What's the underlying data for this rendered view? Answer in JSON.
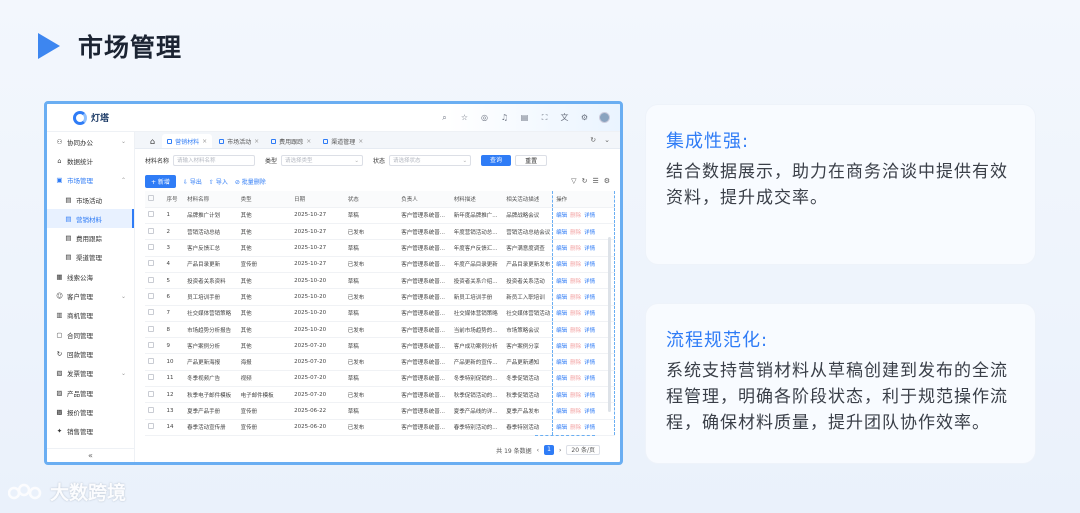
{
  "slide": {
    "title": "市场管理"
  },
  "app": {
    "logo": "灯塔",
    "sidebar": {
      "items": [
        {
          "label": "协同办公",
          "icon": "network-icon",
          "chevron": "⌄"
        },
        {
          "label": "数据统计",
          "icon": "home-icon"
        },
        {
          "label": "市场管理",
          "icon": "folder-icon",
          "chevron": "⌃",
          "open": true
        },
        {
          "label": "市场活动",
          "icon": "doc-icon",
          "sub": true
        },
        {
          "label": "营销材料",
          "icon": "doc-icon",
          "sub": true,
          "active": true
        },
        {
          "label": "费用跟踪",
          "icon": "doc-icon",
          "sub": true
        },
        {
          "label": "渠道管理",
          "icon": "doc-icon",
          "sub": true
        },
        {
          "label": "线索公海",
          "icon": "grid-icon"
        },
        {
          "label": "客户管理",
          "icon": "user-icon",
          "chevron": "⌄"
        },
        {
          "label": "商机管理",
          "icon": "chart-icon"
        },
        {
          "label": "合同管理",
          "icon": "file-icon"
        },
        {
          "label": "回款管理",
          "icon": "refresh-icon"
        },
        {
          "label": "发票管理",
          "icon": "invoice-icon",
          "chevron": "⌄"
        },
        {
          "label": "产品管理",
          "icon": "box-icon"
        },
        {
          "label": "报价管理",
          "icon": "price-icon"
        },
        {
          "label": "销售管理",
          "icon": "sales-icon"
        }
      ],
      "collapse": "«"
    },
    "tabs": [
      {
        "label": "营销材料",
        "active": true
      },
      {
        "label": "市场活动"
      },
      {
        "label": "费用跟踪"
      },
      {
        "label": "渠道管理"
      }
    ],
    "filter": {
      "name_label": "材料名称",
      "name_placeholder": "请输入材料名称",
      "type_label": "类型",
      "type_placeholder": "请选择类型",
      "status_label": "状态",
      "status_placeholder": "请选择状态",
      "search": "查询",
      "reset": "重置"
    },
    "toolbar": {
      "add": "+ 新增",
      "export": "导出",
      "import": "导入",
      "batch_delete": "批量删除"
    },
    "table": {
      "headers": [
        "序号",
        "材料名称",
        "类型",
        "日期",
        "状态",
        "负责人",
        "材料描述",
        "相关活动描述",
        "操作"
      ],
      "actions": {
        "edit": "编辑",
        "delete": "删除",
        "view": "详情"
      },
      "rows": [
        [
          "1",
          "品牌推广计划",
          "其他",
          "2025-10-27",
          "草稿",
          "客户管理系统普...",
          "新年度品牌推广...",
          "品牌战略会议"
        ],
        [
          "2",
          "营销活动总结",
          "其他",
          "2025-10-27",
          "已发布",
          "客户管理系统普...",
          "年度营销活动总...",
          "营销活动总结会议"
        ],
        [
          "3",
          "客户反馈汇总",
          "其他",
          "2025-10-27",
          "草稿",
          "客户管理系统普...",
          "年度客户反馈汇...",
          "客户满意度调查"
        ],
        [
          "4",
          "产品目录更新",
          "宣传册",
          "2025-10-27",
          "已发布",
          "客户管理系统普...",
          "年度产品目录更新",
          "产品目录更新发布"
        ],
        [
          "5",
          "投资者关系资料",
          "其他",
          "2025-10-20",
          "草稿",
          "客户管理系统普...",
          "投资者关系介绍...",
          "投资者关系活动"
        ],
        [
          "6",
          "员工培训手册",
          "其他",
          "2025-10-20",
          "已发布",
          "客户管理系统普...",
          "新员工培训手册",
          "新员工入职培训"
        ],
        [
          "7",
          "社交媒体营销策略",
          "其他",
          "2025-10-20",
          "草稿",
          "客户管理系统普...",
          "社交媒体营销策略",
          "社交媒体营销活动"
        ],
        [
          "8",
          "市场趋势分析报告",
          "其他",
          "2025-10-20",
          "已发布",
          "客户管理系统普...",
          "当前市场趋势的...",
          "市场策略会议"
        ],
        [
          "9",
          "客户案例分析",
          "其他",
          "2025-07-20",
          "草稿",
          "客户管理系统普...",
          "客户成功案例分析",
          "客户案例分享"
        ],
        [
          "10",
          "产品更新海报",
          "海报",
          "2025-07-20",
          "已发布",
          "客户管理系统普...",
          "产品更新的宣传...",
          "产品更新通知"
        ],
        [
          "11",
          "冬季视频广告",
          "视频",
          "2025-07-20",
          "草稿",
          "客户管理系统普...",
          "冬季特别促销的...",
          "冬季促销活动"
        ],
        [
          "12",
          "秋季电子邮件模板",
          "电子邮件模板",
          "2025-07-20",
          "已发布",
          "客户管理系统普...",
          "秋季促销活动的...",
          "秋季促销活动"
        ],
        [
          "13",
          "夏季产品手册",
          "宣传册",
          "2025-06-22",
          "草稿",
          "客户管理系统普...",
          "夏季产品线的详...",
          "夏季产品发布"
        ],
        [
          "14",
          "春季活动宣传册",
          "宣传册",
          "2025-06-20",
          "已发布",
          "客户管理系统普...",
          "春季特别活动的...",
          "春季特别活动"
        ]
      ]
    },
    "pager": {
      "total": "共 19 条数据",
      "current": "1",
      "size": "20 条/页"
    }
  },
  "cards": [
    {
      "title": "集成性强:",
      "body": "结合数据展示，助力在商务洽谈中提供有效资料，提升成交率。"
    },
    {
      "title": "流程规范化:",
      "body": "系统支持营销材料从草稿创建到发布的全流程管理，明确各阶段状态，利于规范操作流程，确保材料质量，提升团队协作效率。"
    }
  ],
  "watermark": "大数跨境"
}
